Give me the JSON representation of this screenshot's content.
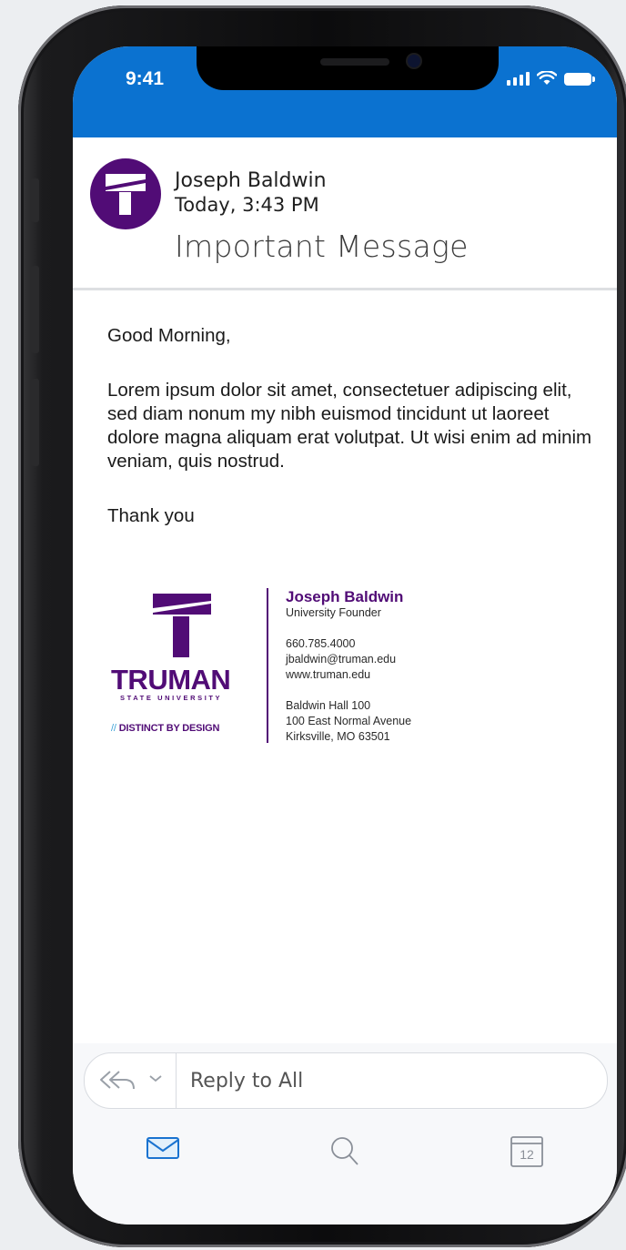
{
  "status_bar": {
    "time": "9:41"
  },
  "message": {
    "sender": "Joseph Baldwin",
    "date": "Today, 3:43 PM",
    "subject": "Important Message",
    "greeting": "Good Morning,",
    "body": "Lorem ipsum dolor sit amet, consectetuer adipiscing elit, sed diam nonum my nibh euismod tincidunt ut laoreet dolore magna aliquam erat volutpat. Ut wisi enim ad minim veniam, quis nostrud.",
    "closing": "Thank you"
  },
  "signature": {
    "logo_name": "TRUMAN",
    "logo_sub": "STATE UNIVERSITY",
    "tagline_mark": "//",
    "tagline": "DISTINCT BY DESIGN",
    "name": "Joseph Baldwin",
    "title": "University Founder",
    "phone": "660.785.4000",
    "email": "jbaldwin@truman.edu",
    "website": "www.truman.edu",
    "address_line1": "Baldwin Hall 100",
    "address_line2": "100 East Normal Avenue",
    "address_line3": "Kirksville, MO 63501"
  },
  "reply": {
    "label": "Reply to All"
  },
  "tabbar": {
    "calendar_day": "12",
    "icons": [
      "mail-icon",
      "search-icon",
      "calendar-icon"
    ]
  },
  "colors": {
    "accent_blue": "#0b72d0",
    "truman_purple": "#510c76",
    "tagline_blue": "#3aa1d6"
  }
}
